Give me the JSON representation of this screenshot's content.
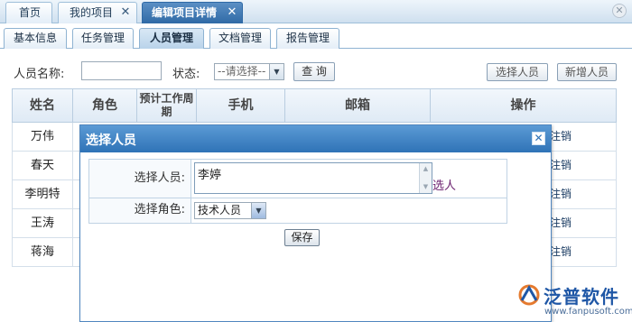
{
  "top_tabs": [
    {
      "label": "首页",
      "closable": false
    },
    {
      "label": "我的项目",
      "closable": true
    },
    {
      "label": "编辑项目详情",
      "closable": true,
      "active": true
    }
  ],
  "sub_tabs": [
    "基本信息",
    "任务管理",
    "人员管理",
    "文档管理",
    "报告管理"
  ],
  "active_sub_tab": "人员管理",
  "search": {
    "name_label": "人员名称:",
    "name_value": "",
    "status_label": "状态:",
    "status_selected": "--请选择--",
    "query_button": "查 询",
    "select_person_button": "选择人员",
    "add_person_button": "新增人员"
  },
  "table": {
    "headers": [
      "姓名",
      "角色",
      "预计工作周期",
      "手机",
      "邮箱",
      "操作"
    ],
    "rows": [
      {
        "name": "万伟",
        "action": "注销"
      },
      {
        "name": "春天",
        "action": "注销"
      },
      {
        "name": "李明特",
        "action": "注销"
      },
      {
        "name": "王涛",
        "action": "注销"
      },
      {
        "name": "蒋海",
        "action": "注销"
      }
    ]
  },
  "dialog": {
    "title": "选择人员",
    "close_icon": "close-icon",
    "person_label": "选择人员:",
    "person_value": "李婷",
    "pick_link": "选人",
    "role_label": "选择角色:",
    "role_selected": "技术人员",
    "save_button": "保存"
  },
  "brand": {
    "name": "泛普软件",
    "url": "www.fanpusoft.com"
  },
  "colors": {
    "accent": "#2f73b7",
    "header_bg": "#dfeaf5",
    "link": "#6a1f6e"
  }
}
